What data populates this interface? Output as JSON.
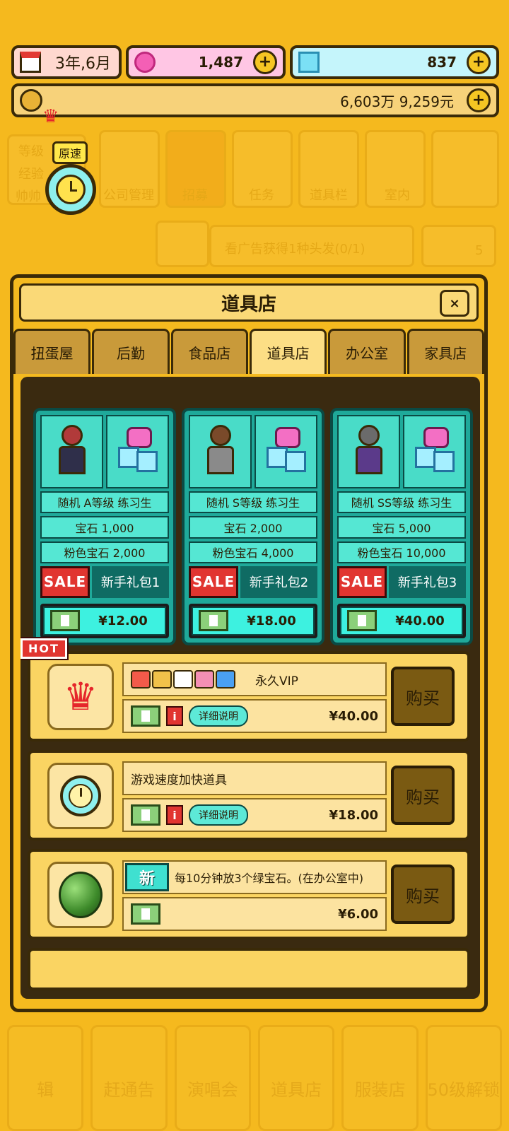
{
  "header": {
    "date": "3年,6月",
    "pink_gems": "1,487",
    "diamonds": "837",
    "money": "6,603万 9,259元",
    "speed_label": "原速"
  },
  "background": {
    "menu": [
      "等级",
      "经验",
      "帅帅",
      "公司管理",
      "招募",
      "任务",
      "道具栏",
      "室内"
    ],
    "ad_banner": "看广告获得1种头发(0/1)",
    "ad_count": "5",
    "bottom": [
      "辑",
      "赶通告",
      "演唱会",
      "道具店",
      "服装店",
      "50级解锁"
    ]
  },
  "modal": {
    "title": "道具店",
    "close": "×",
    "tabs": [
      "扭蛋屋",
      "后勤",
      "食品店",
      "道具店",
      "办公室",
      "家具店"
    ],
    "active_tab": 3
  },
  "packs": [
    {
      "rank_badge": "A",
      "trainee": "随机 A等级 练习生",
      "gems": "宝石 1,000",
      "pink_gems": "粉色宝石 2,000",
      "sale": "SALE",
      "name": "新手礼包1",
      "price": "¥12.00"
    },
    {
      "rank_badge": "S",
      "trainee": "随机 S等级 练习生",
      "gems": "宝石 2,000",
      "pink_gems": "粉色宝石 4,000",
      "sale": "SALE",
      "name": "新手礼包2",
      "price": "¥18.00"
    },
    {
      "rank_badge": "SS",
      "trainee": "随机 SS等级 练习生",
      "gems": "宝石 5,000",
      "pink_gems": "粉色宝石 10,000",
      "sale": "SALE",
      "name": "新手礼包3",
      "price": "¥40.00"
    }
  ],
  "items": [
    {
      "hot": "HOT",
      "name": "永久VIP",
      "detail": "详细说明",
      "price": "¥40.00",
      "buy": "购买"
    },
    {
      "name": "游戏速度加快道具",
      "detail": "详细说明",
      "price": "¥18.00",
      "buy": "购买"
    },
    {
      "new": "新",
      "name": "每10分钟放3个绿宝石。(在办公室中)",
      "price": "¥6.00",
      "buy": "购买"
    }
  ],
  "colors": {
    "accent": "#F5BA1F",
    "teal": "#1FA99A",
    "sale_red": "#E13530"
  }
}
